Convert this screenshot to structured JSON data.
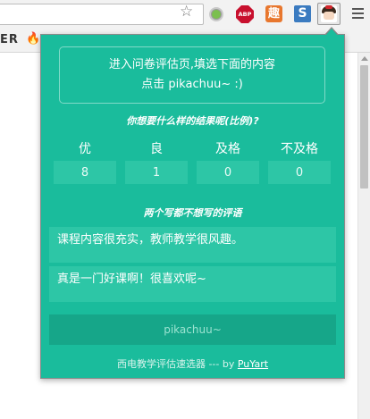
{
  "toolbar": {
    "abp_label": "ABP",
    "orange_ext_label": "趣",
    "blue_ext_label": "S"
  },
  "bookmarks": {
    "partial_text": "ER"
  },
  "popup": {
    "intro_line1": "进入问卷评估页,填选下面的内容",
    "intro_line2": "点击 pikachuu~ :)",
    "ratio_title": "你想要什么样的结果呢(比例)?",
    "grades": [
      {
        "label": "优",
        "value": "8"
      },
      {
        "label": "良",
        "value": "1"
      },
      {
        "label": "及格",
        "value": "0"
      },
      {
        "label": "不及格",
        "value": "0"
      }
    ],
    "comments_title": "两个写都不想写的评语",
    "comments": [
      "课程内容很充实，教师教学很风趣。",
      "真是一门好课啊！很喜欢呢~"
    ],
    "submit_label": "pikachuu~",
    "footer_text": "西电教学评估速选器 --- by ",
    "footer_link": "PuYart"
  },
  "colors": {
    "popup_bg": "#1abc9c",
    "input_bg": "#2dc6a6",
    "button_bg": "#16a689"
  }
}
